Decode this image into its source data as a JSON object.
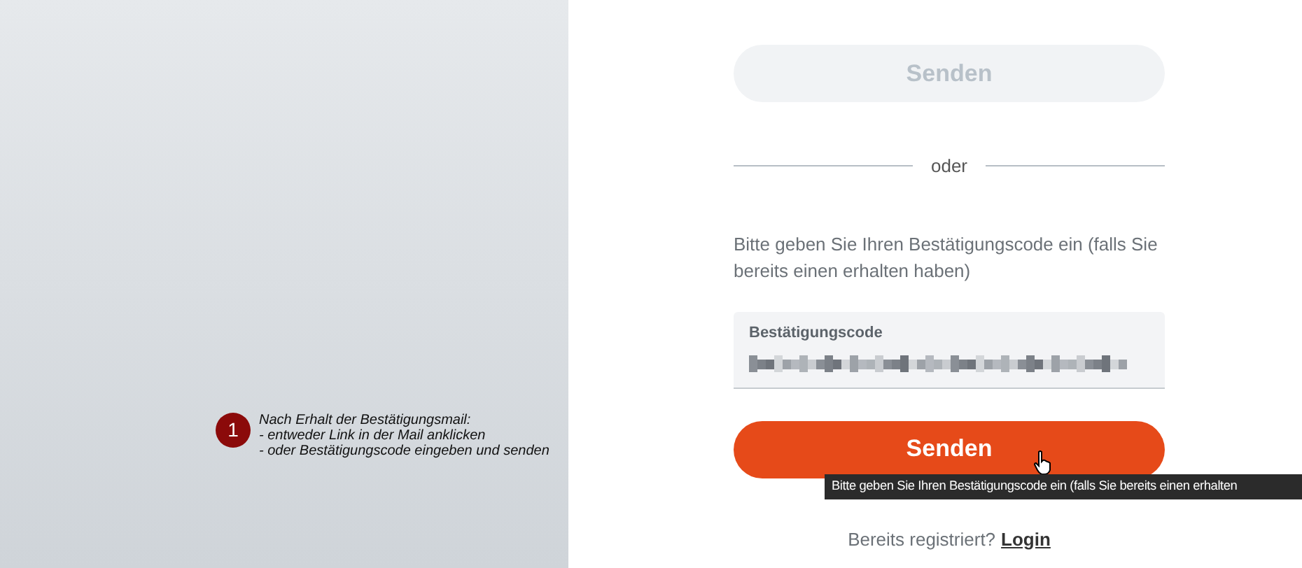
{
  "annotation": {
    "number": "1",
    "lines": [
      "Nach Erhalt der Bestätigungsmail:",
      "- entweder Link in der Mail anklicken",
      "- oder Bestätigungscode eingeben und senden"
    ]
  },
  "form": {
    "top_button": {
      "label": "Senden",
      "disabled": true
    },
    "divider": "oder",
    "instruction": "Bitte geben Sie Ihren Bestätigungscode ein (falls Sie bereits einen erhalten haben)",
    "code_field": {
      "label": "Bestätigungscode"
    },
    "submit_button": {
      "label": "Senden",
      "disabled": false
    },
    "tooltip": "Bitte geben Sie Ihren Bestätigungscode ein (falls Sie bereits einen erhalten",
    "footer": {
      "text": "Bereits registriert?",
      "link": "Login"
    }
  }
}
